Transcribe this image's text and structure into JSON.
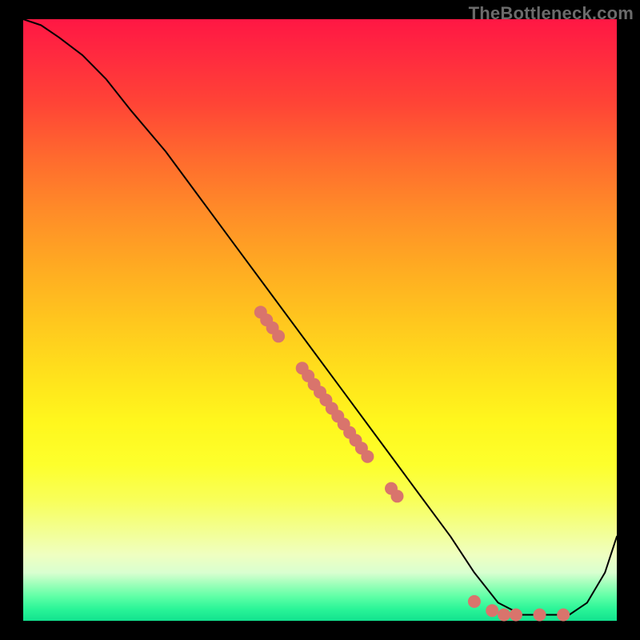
{
  "watermark": "TheBottleneck.com",
  "chart_data": {
    "type": "line",
    "title": "",
    "xlabel": "",
    "ylabel": "",
    "xlim": [
      0,
      100
    ],
    "ylim": [
      0,
      100
    ],
    "grid": false,
    "series": [
      {
        "name": "curve",
        "color": "#000000",
        "stroke_width": 2,
        "x": [
          0,
          3,
          6,
          10,
          14,
          18,
          24,
          30,
          36,
          42,
          48,
          54,
          60,
          66,
          72,
          76,
          80,
          84,
          88,
          92,
          95,
          98,
          100
        ],
        "y": [
          100,
          99,
          97,
          94,
          90,
          85,
          78,
          70,
          62,
          54,
          46,
          38,
          30,
          22,
          14,
          8,
          3,
          1,
          1,
          1,
          3,
          8,
          14
        ]
      }
    ],
    "markers": {
      "color": "#d9746c",
      "radius_px": 8,
      "points": [
        {
          "x": 40,
          "y": 51.3
        },
        {
          "x": 41,
          "y": 50.0
        },
        {
          "x": 42,
          "y": 48.7
        },
        {
          "x": 43,
          "y": 47.3
        },
        {
          "x": 47,
          "y": 42.0
        },
        {
          "x": 48,
          "y": 40.7
        },
        {
          "x": 49,
          "y": 39.3
        },
        {
          "x": 50,
          "y": 38.0
        },
        {
          "x": 51,
          "y": 36.7
        },
        {
          "x": 52,
          "y": 35.3
        },
        {
          "x": 53,
          "y": 34.0
        },
        {
          "x": 54,
          "y": 32.7
        },
        {
          "x": 55,
          "y": 31.3
        },
        {
          "x": 56,
          "y": 30.0
        },
        {
          "x": 57,
          "y": 28.7
        },
        {
          "x": 58,
          "y": 27.3
        },
        {
          "x": 62,
          "y": 22.0
        },
        {
          "x": 63,
          "y": 20.7
        },
        {
          "x": 76,
          "y": 3.2
        },
        {
          "x": 79,
          "y": 1.7
        },
        {
          "x": 81,
          "y": 1.0
        },
        {
          "x": 83,
          "y": 1.0
        },
        {
          "x": 87,
          "y": 1.0
        },
        {
          "x": 91,
          "y": 1.0
        }
      ]
    }
  }
}
